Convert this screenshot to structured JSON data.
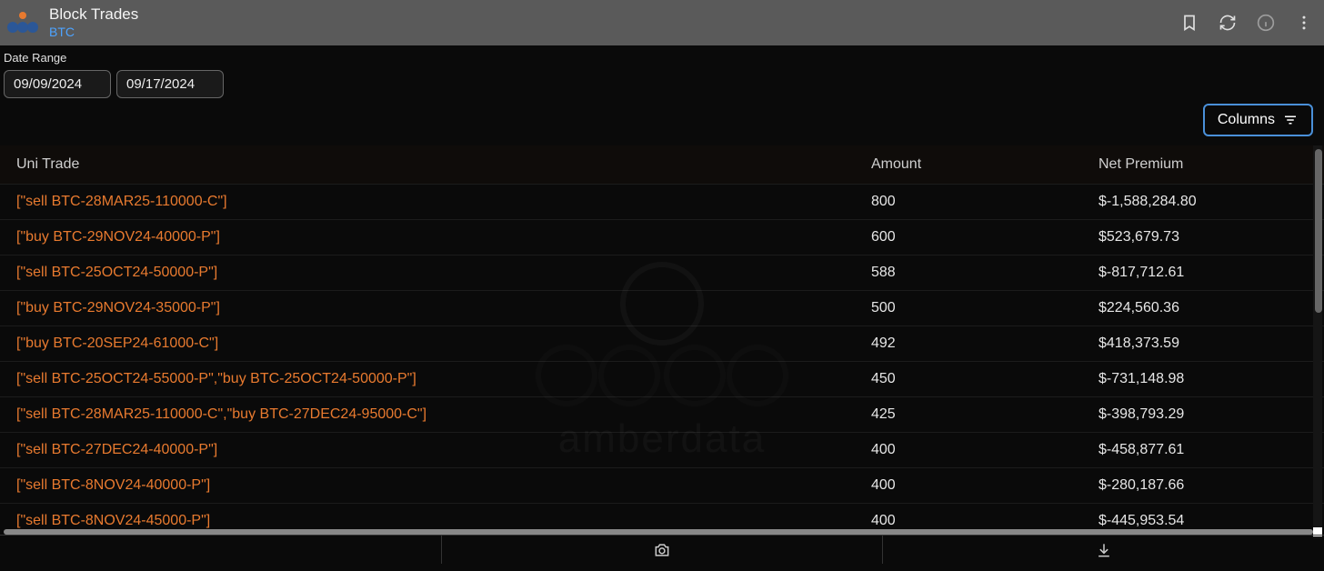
{
  "header": {
    "title": "Block Trades",
    "subtitle": "BTC"
  },
  "dateRange": {
    "label": "Date Range",
    "start": "09/09/2024",
    "end": "09/17/2024"
  },
  "columnsButton": "Columns",
  "watermark": "amberdata",
  "table": {
    "headers": {
      "trade": "Uni Trade",
      "amount": "Amount",
      "net": "Net Premium"
    },
    "rows": [
      {
        "trade": "[\"sell BTC-28MAR25-110000-C\"]",
        "amount": "800",
        "net": "$-1,588,284.80"
      },
      {
        "trade": "[\"buy BTC-29NOV24-40000-P\"]",
        "amount": "600",
        "net": "$523,679.73"
      },
      {
        "trade": "[\"sell BTC-25OCT24-50000-P\"]",
        "amount": "588",
        "net": "$-817,712.61"
      },
      {
        "trade": "[\"buy BTC-29NOV24-35000-P\"]",
        "amount": "500",
        "net": "$224,560.36"
      },
      {
        "trade": "[\"buy BTC-20SEP24-61000-C\"]",
        "amount": "492",
        "net": "$418,373.59"
      },
      {
        "trade": "[\"sell BTC-25OCT24-55000-P\",\"buy BTC-25OCT24-50000-P\"]",
        "amount": "450",
        "net": "$-731,148.98"
      },
      {
        "trade": "[\"sell BTC-28MAR25-110000-C\",\"buy BTC-27DEC24-95000-C\"]",
        "amount": "425",
        "net": "$-398,793.29"
      },
      {
        "trade": "[\"sell BTC-27DEC24-40000-P\"]",
        "amount": "400",
        "net": "$-458,877.61"
      },
      {
        "trade": "[\"sell BTC-8NOV24-40000-P\"]",
        "amount": "400",
        "net": "$-280,187.66"
      },
      {
        "trade": "[\"sell BTC-8NOV24-45000-P\"]",
        "amount": "400",
        "net": "$-445,953.54"
      }
    ]
  }
}
